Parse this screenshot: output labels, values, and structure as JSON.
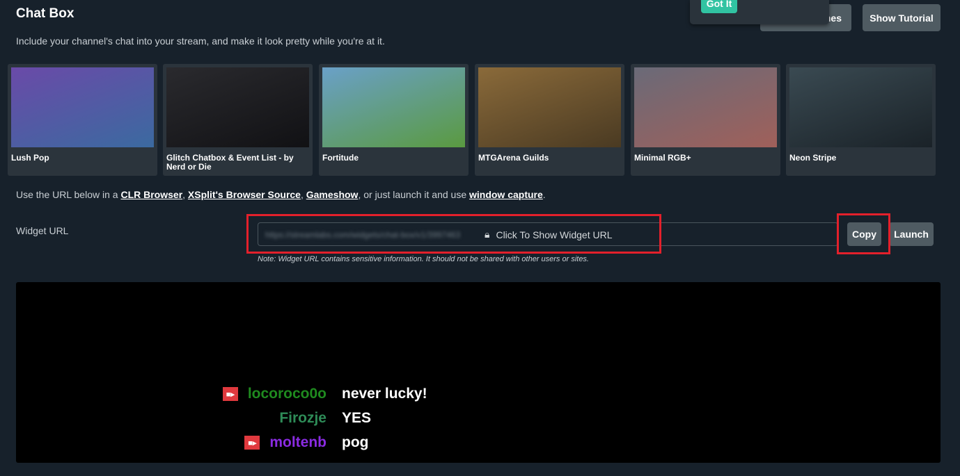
{
  "header": {
    "title": "Chat Box",
    "subtitle": "Include your channel's chat into your stream, and make it look pretty while you're at it.",
    "themes_button": "Widget Themes",
    "themes_button_visible": "nes",
    "tutorial_button": "Show Tutorial",
    "popup_button": "Got It"
  },
  "themes": [
    {
      "label": "Lush Pop",
      "colors": [
        "#6a4aa8",
        "#3b6aa0"
      ]
    },
    {
      "label": "Glitch Chatbox & Event List - by Nerd or Die",
      "colors": [
        "#2a2a2e",
        "#111114"
      ]
    },
    {
      "label": "Fortitude",
      "colors": [
        "#6aa0c8",
        "#5a9a40"
      ]
    },
    {
      "label": "MTGArena Guilds",
      "colors": [
        "#8a6a3a",
        "#4a3a22"
      ]
    },
    {
      "label": "Minimal RGB+",
      "colors": [
        "#6a6a78",
        "#a0605a"
      ]
    },
    {
      "label": "Neon Stripe",
      "colors": [
        "#3a4a52",
        "#1a2228"
      ]
    }
  ],
  "url_info": {
    "prefix": "Use the URL below in a ",
    "link1": "CLR Browser",
    "sep1": ", ",
    "link2": "XSplit's Browser Source",
    "sep2": ", ",
    "link3": "Gameshow",
    "mid": ", or just launch it and use ",
    "link4": "window capture",
    "end": "."
  },
  "widget": {
    "label": "Widget URL",
    "blurred_url": "https://streamlabs.com/widgets/chat-box/v1/3997463",
    "show_text": "Click To Show Widget URL",
    "copy": "Copy",
    "launch": "Launch",
    "note": "Note: Widget URL contains sensitive information. It should not be shared with other users or sites."
  },
  "chat": [
    {
      "user": "locoroco0o",
      "message": "never lucky!",
      "color": "#1f8a1f",
      "badge": true
    },
    {
      "user": "Firozje",
      "message": "YES",
      "color": "#2e8b57",
      "badge": false
    },
    {
      "user": "moltenb",
      "message": "pog",
      "color": "#8a2be2",
      "badge": true
    }
  ],
  "colors": {
    "highlight": "#e3202b",
    "accent": "#31c3a2"
  }
}
